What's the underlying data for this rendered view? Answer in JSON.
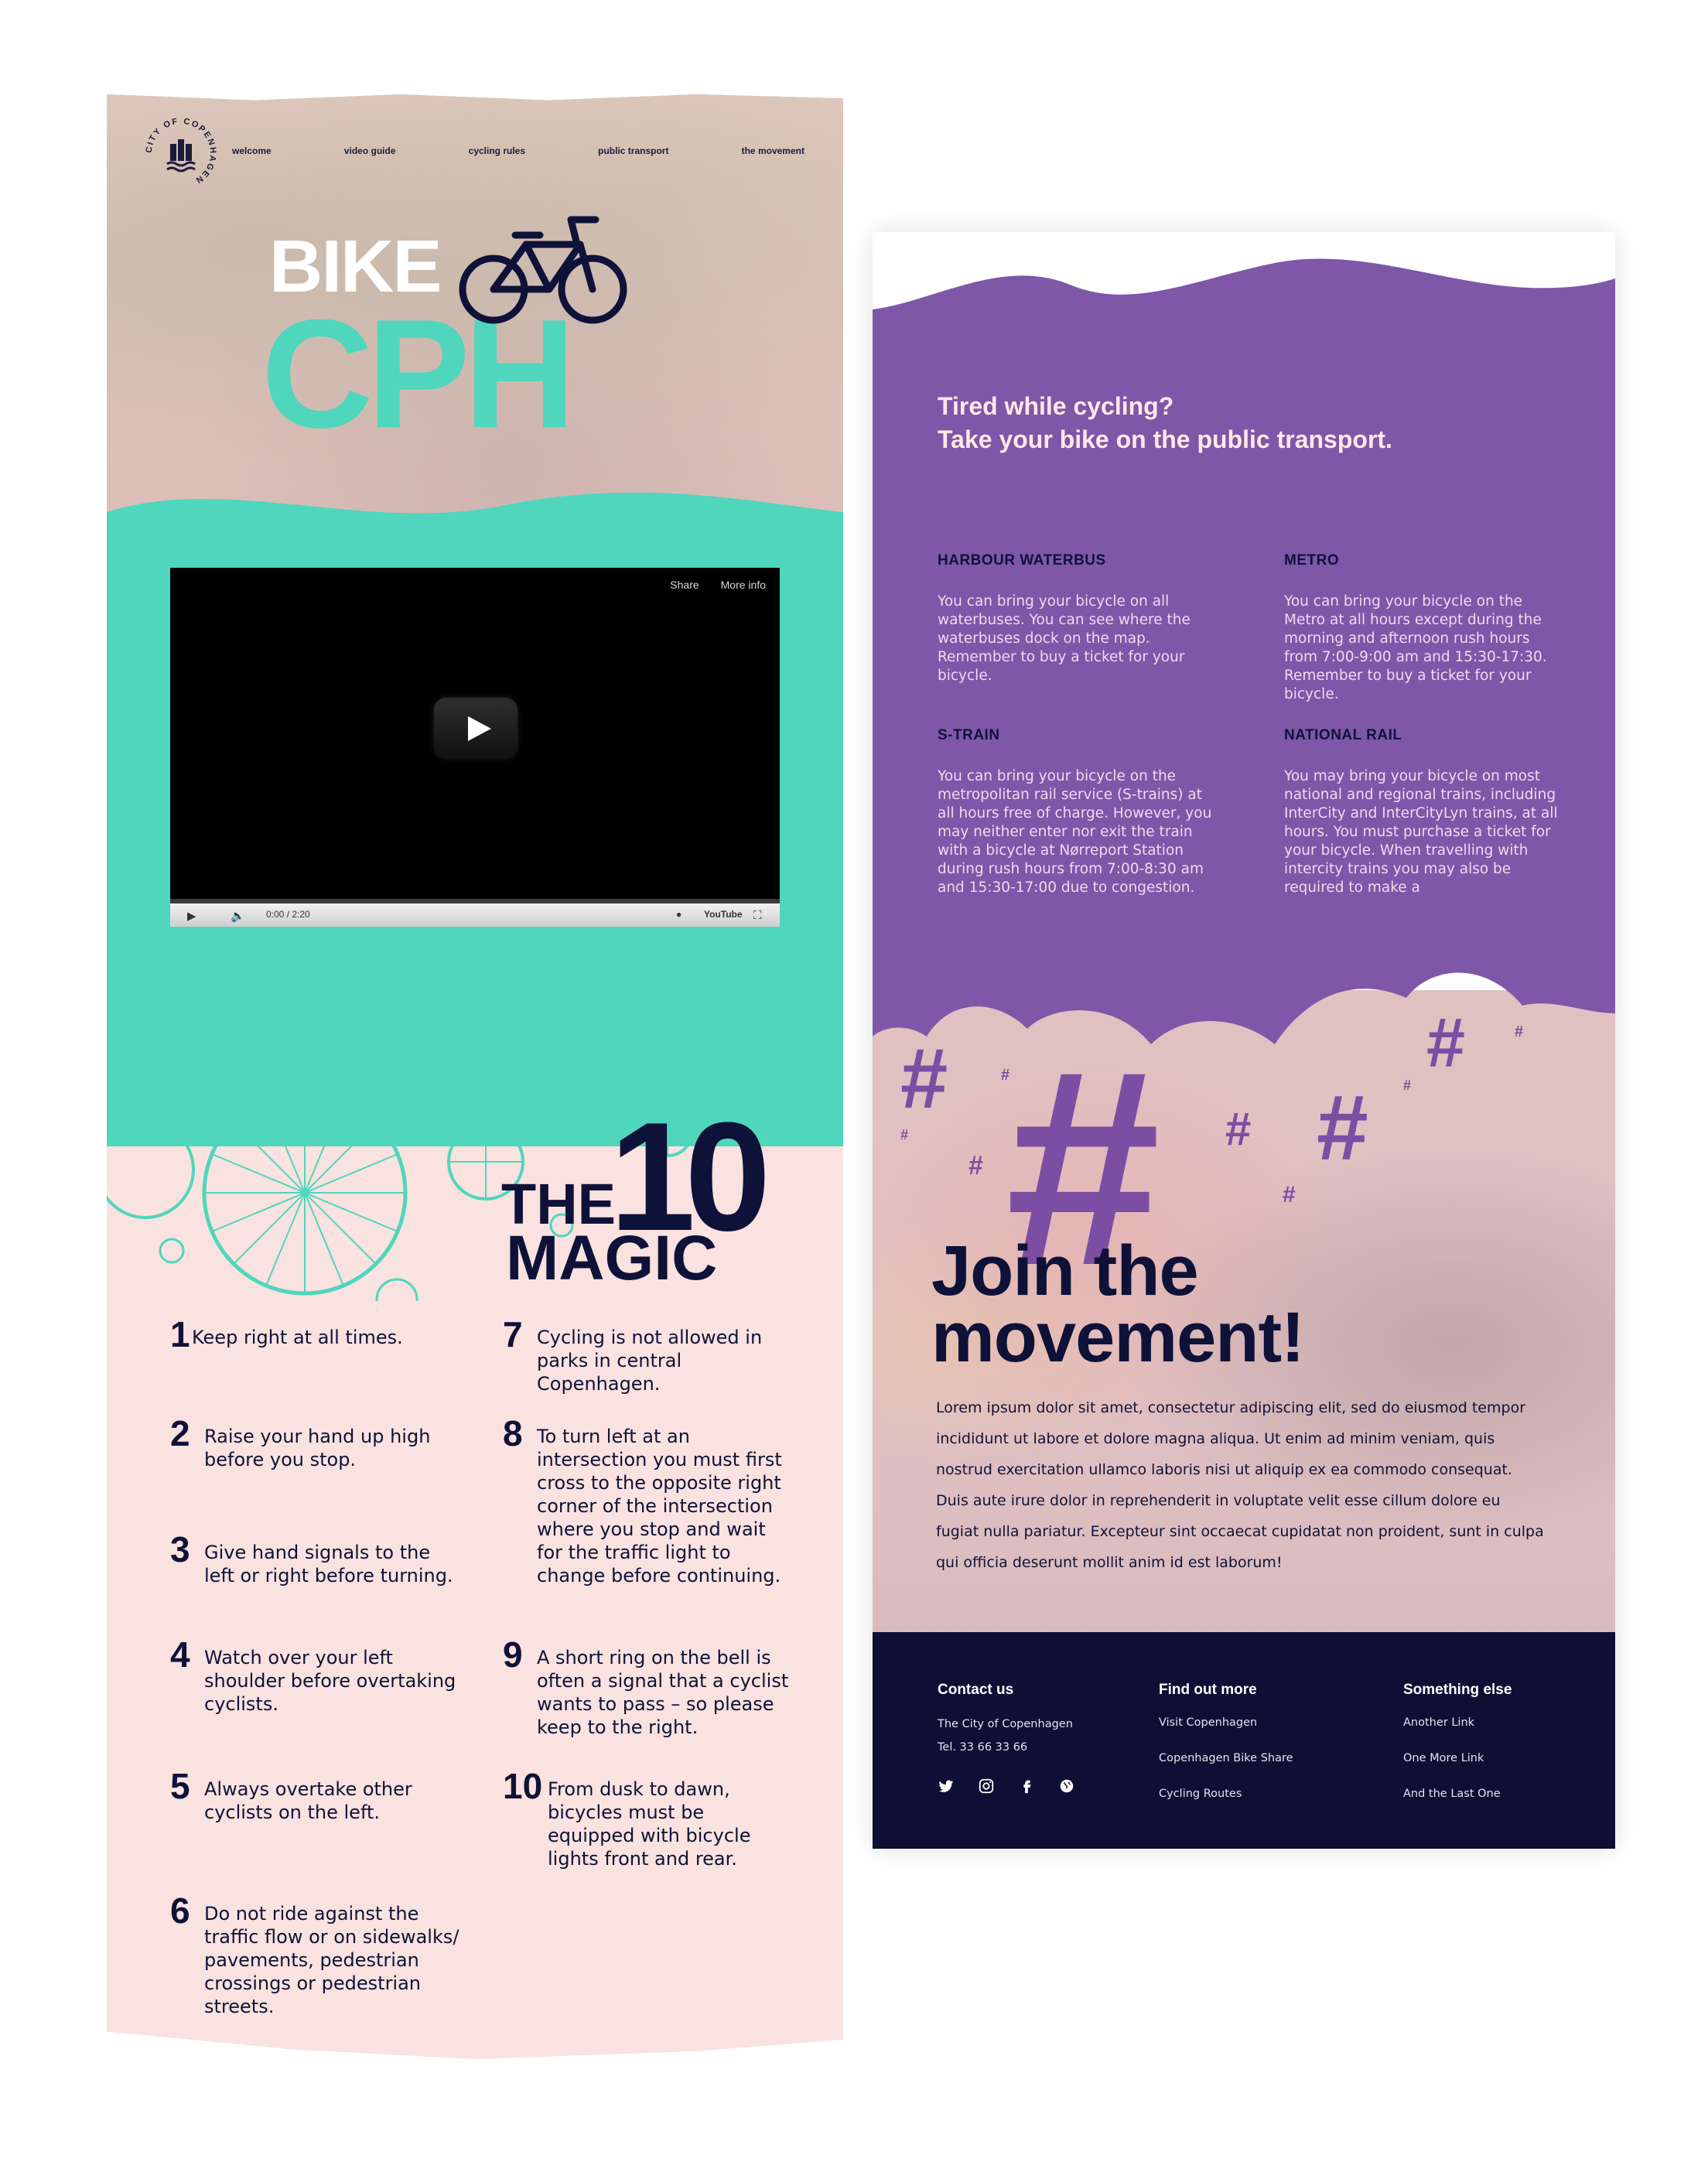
{
  "left": {
    "logo_text": "CITY OF COPENHAGEN",
    "nav": [
      "welcome",
      "video guide",
      "cycling rules",
      "public transport",
      "the movement"
    ],
    "title_bike": "BIKE",
    "title_cph": "CPH",
    "video": {
      "share": "Share",
      "more_info": "More info",
      "time": "0:00 / 2:20",
      "brand": "YouTube"
    },
    "magic": {
      "the": "THE",
      "ten": "10",
      "magic": "MAGIC"
    },
    "rules": [
      {
        "num": "1",
        "text": "Keep right at all times."
      },
      {
        "num": "2",
        "text": "Raise your hand up high before you stop."
      },
      {
        "num": "3",
        "text": "Give hand signals to the left or right before turning."
      },
      {
        "num": "4",
        "text": "Watch over your left shoulder before overtaking cyclists."
      },
      {
        "num": "5",
        "text": "Always overtake other cyclists on the left."
      },
      {
        "num": "6",
        "text": "Do not ride against the traffic flow or on sidewalks/ pavements, pedestrian crossings or pedestrian streets."
      },
      {
        "num": "7",
        "text": "Cycling is not allowed in parks in central Copenhagen."
      },
      {
        "num": "8",
        "text": "To turn left at an intersection you must first cross to the opposite right corner of the intersection where you stop and wait for the traffic light to change before continuing."
      },
      {
        "num": "9",
        "text": "A short ring on the bell is often a signal that a cyclist wants to pass – so please keep to the right."
      },
      {
        "num": "10",
        "text": "From dusk to dawn, bicycles must be equipped with bicycle lights front and rear."
      }
    ]
  },
  "right": {
    "heading_line1": "Tired while cycling?",
    "heading_line2": "Take your bike on the public transport.",
    "modes": [
      {
        "title": "HARBOUR WATERBUS",
        "text": "You can bring your bicycle on all waterbuses. You can see where the waterbuses dock on the map. Remember to buy a ticket for your bicycle."
      },
      {
        "title": "METRO",
        "text": "You can bring your bicycle on the Metro at all hours except during the morning and afternoon rush hours from 7:00-9:00 am and 15:30-17:30. Remember to buy a ticket for your bicycle."
      },
      {
        "title": "S-TRAIN",
        "text": "You can bring your bicycle on the metropolitan rail service (S-trains) at all hours free of charge. However, you may neither enter nor exit the train with a bicycle at Nørreport Station during rush hours from 7:00-8:30 am and 15:30-17:00 due to congestion."
      },
      {
        "title": "NATIONAL RAIL",
        "text": "You may bring your bicycle on most national and regional trains, including InterCity and InterCityLyn trains, at all hours. You must purchase a ticket for your bicycle. When travelling with intercity trains you may also be required to make a"
      }
    ],
    "hash_symbol": "#",
    "movement_title_1": "Join the",
    "movement_title_2": "movement!",
    "movement_body": "Lorem ipsum dolor sit amet, consectetur adipiscing elit, sed do eiusmod tempor incididunt ut labore et dolore magna aliqua. Ut enim ad minim veniam, quis nostrud exercitation ullamco laboris nisi ut aliquip ex ea commodo consequat. Duis aute irure dolor in reprehenderit in voluptate velit esse cillum dolore eu fugiat nulla pariatur. Excepteur sint occaecat cupidatat non proident, sunt in culpa qui officia deserunt mollit anim id est laborum!",
    "footer": {
      "contact_heading": "Contact us",
      "contact_lines": [
        "The City of Copenhagen",
        "Tel. 33 66 33 66"
      ],
      "find_heading": "Find out more",
      "find_links": [
        "Visit Copenhagen",
        "Copenhagen Bike Share",
        "Cycling Routes"
      ],
      "else_heading": "Something else",
      "else_links": [
        "Another Link",
        "One More Link",
        "And the Last One"
      ],
      "social": [
        "twitter-icon",
        "instagram-icon",
        "facebook-icon",
        "globe-icon"
      ]
    }
  },
  "colors": {
    "mint": "#4fd6bd",
    "navy": "#0f1238",
    "purple": "#7e57a8",
    "pink": "#f9e2df",
    "footer": "#0d1034"
  }
}
